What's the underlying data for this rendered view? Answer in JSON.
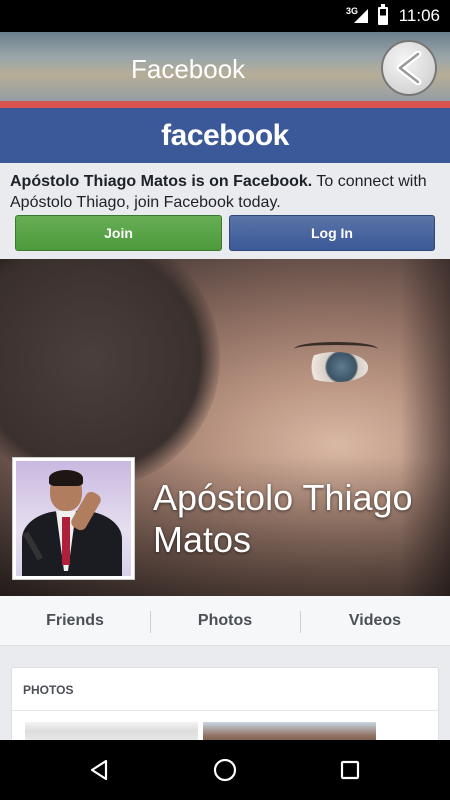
{
  "status_bar": {
    "network": "3G",
    "time": "11:06"
  },
  "header": {
    "title": "Facebook",
    "back_icon": "chevron-left-icon"
  },
  "fb_bar": {
    "logo": "facebook"
  },
  "join_panel": {
    "bold_text": "Apóstolo Thiago Matos is on Facebook.",
    "rest_text": " To connect with Apóstolo Thiago, join Facebook today.",
    "join_label": "Join",
    "login_label": "Log In"
  },
  "profile": {
    "name": "Apóstolo Thiago Matos"
  },
  "tabs": [
    {
      "label": "Friends"
    },
    {
      "label": "Photos"
    },
    {
      "label": "Videos"
    }
  ],
  "photos_card": {
    "heading": "PHOTOS"
  },
  "colors": {
    "facebook_blue": "#3b5998",
    "join_green": "#4d9a3c",
    "header_stripe": "#d9534f"
  },
  "nav": {
    "back_icon": "triangle-back-icon",
    "home_icon": "circle-home-icon",
    "recent_icon": "square-recents-icon"
  }
}
